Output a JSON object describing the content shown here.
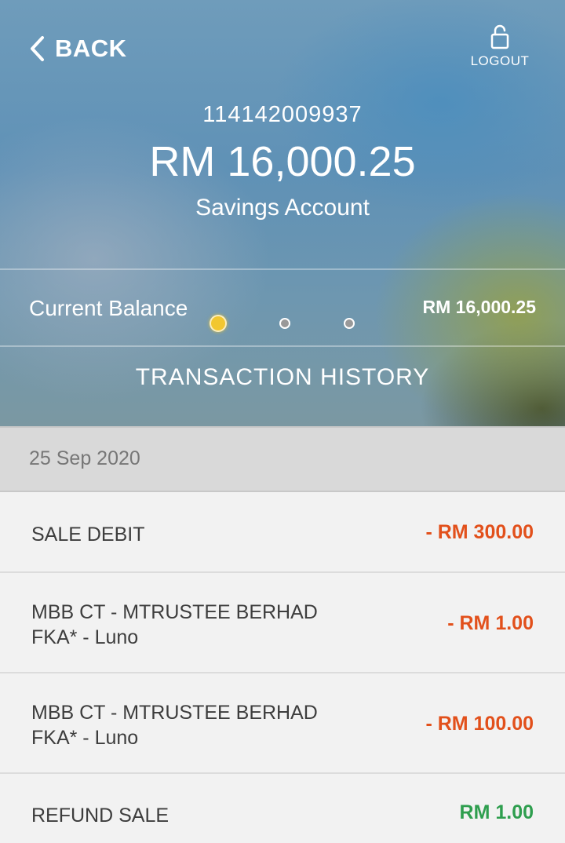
{
  "header": {
    "back_label": "BACK",
    "logout_label": "LOGOUT"
  },
  "account": {
    "number": "114142009937",
    "amount": "RM 16,000.25",
    "type": "Savings Account"
  },
  "balance": {
    "label": "Current Balance",
    "value": "RM 16,000.25"
  },
  "pager": {
    "total": 3,
    "active": 1
  },
  "tabs": {
    "transaction_history": "TRANSACTION HISTORY"
  },
  "transactions": {
    "date": "25 Sep 2020",
    "items": [
      {
        "line1": "SALE DEBIT",
        "line2": "",
        "amount": "- RM 300.00",
        "kind": "debit"
      },
      {
        "line1": "MBB CT - MTRUSTEE BERHAD",
        "line2": "FKA* - Luno",
        "amount": "- RM 1.00",
        "kind": "debit"
      },
      {
        "line1": "MBB CT - MTRUSTEE BERHAD",
        "line2": "FKA* - Luno",
        "amount": "- RM 100.00",
        "kind": "debit"
      },
      {
        "line1": "REFUND SALE",
        "line2": "",
        "amount": "RM 1.00",
        "kind": "credit"
      }
    ]
  },
  "colors": {
    "debit": "#e2501b",
    "credit": "#2e9e4e",
    "active_dot": "#f2c730"
  },
  "icons": {
    "back": "chevron-left-icon",
    "logout": "unlocked-padlock-icon"
  }
}
